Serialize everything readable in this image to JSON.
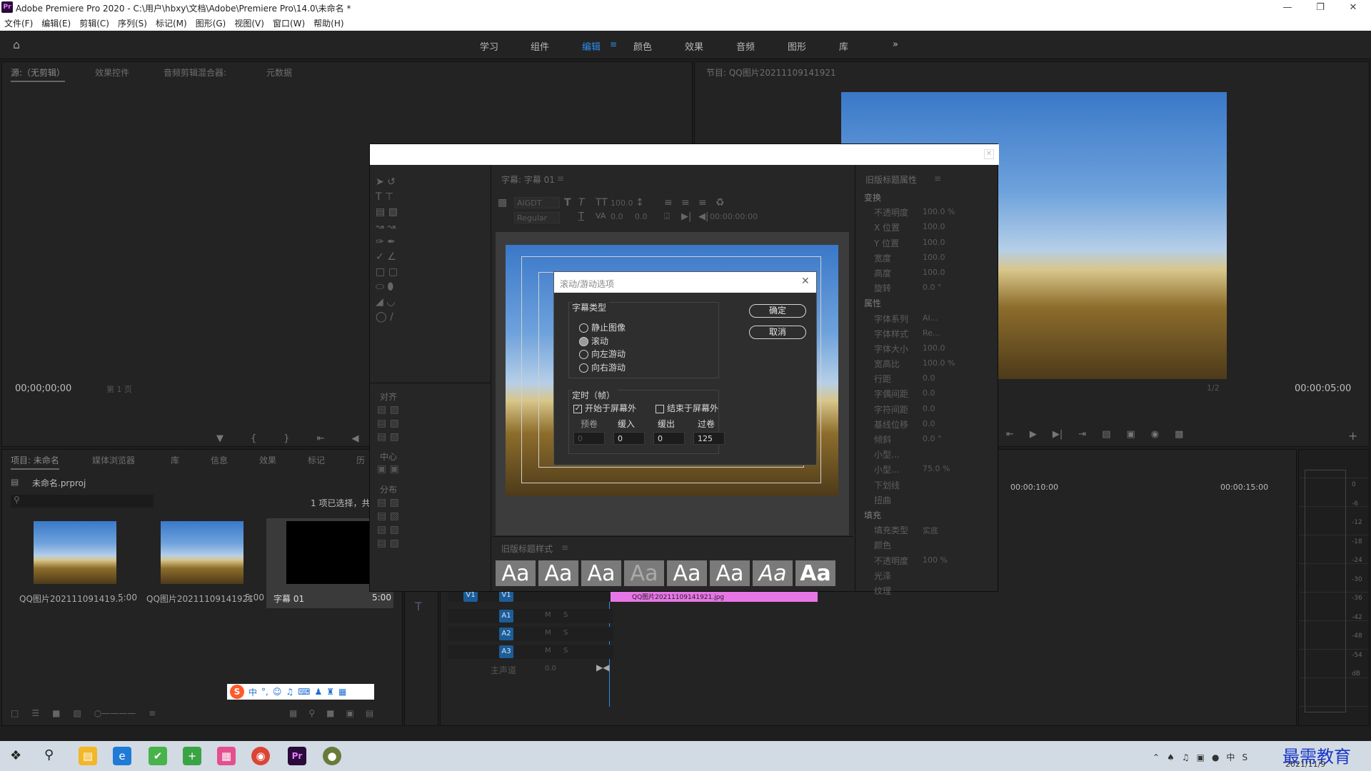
{
  "window": {
    "title": "Adobe Premiere Pro 2020 - C:\\用户\\hbxy\\文档\\Adobe\\Premiere Pro\\14.0\\未命名 *",
    "app_icon": "Pr"
  },
  "menu": [
    "文件(F)",
    "编辑(E)",
    "剪辑(C)",
    "序列(S)",
    "标记(M)",
    "图形(G)",
    "视图(V)",
    "窗口(W)",
    "帮助(H)"
  ],
  "workspaces": [
    "学习",
    "组件",
    "编辑",
    "颜色",
    "效果",
    "音频",
    "图形",
    "库"
  ],
  "active_workspace": "编辑",
  "source_panel": {
    "tabs": [
      "源:（无剪辑）",
      "效果控件",
      "音频剪辑混合器:",
      "元数据"
    ],
    "timecode": "00;00;00;00",
    "page": "第 1 页"
  },
  "program_panel": {
    "title": "节目: QQ图片20211109141921",
    "timecode": "00:00:05:00",
    "zoom": "1/2"
  },
  "project_panel": {
    "tabs": [
      "项目: 未命名",
      "媒体浏览器",
      "库",
      "信息",
      "效果",
      "标记",
      "历"
    ],
    "file": "未命名.prproj",
    "selection": "1 项已选择，共",
    "items": [
      {
        "name": "QQ图片202111091419...",
        "dur": "5:00"
      },
      {
        "name": "QQ图片20211109141921",
        "dur": "5:00"
      },
      {
        "name": "字幕 01",
        "dur": "5:00"
      }
    ]
  },
  "timeline": {
    "ruler": [
      "00:00:10:00",
      "00:00:15:00"
    ],
    "tracks": [
      "V1",
      "A1",
      "A2",
      "A3"
    ],
    "master": "主声道",
    "master_val": "0.0",
    "clip_label": "QQ图片20211109141921.jpg",
    "track_btns": [
      "M",
      "S"
    ]
  },
  "meters": {
    "scale": [
      "0",
      "-6",
      "-12",
      "-18",
      "-24",
      "-30",
      "-36",
      "-42",
      "-48",
      "-54",
      "dB"
    ]
  },
  "legacy_title": {
    "panel_title": "字幕: 字幕 01",
    "font_family": "AIGDT",
    "font_style": "Regular",
    "font_size": "100.0",
    "kerning": "0.0",
    "leading": "0.0",
    "tab_time": "00:00:00:00",
    "align_label": "对齐",
    "center_label": "中心",
    "distribute_label": "分布",
    "styles_title": "旧版标题样式",
    "style_sample": "Aa",
    "props_title": "旧版标题属性",
    "props": [
      {
        "group": "变换"
      },
      {
        "label": "不透明度",
        "value": "100.0 %"
      },
      {
        "label": "X 位置",
        "value": "100.0"
      },
      {
        "label": "Y 位置",
        "value": "100.0"
      },
      {
        "label": "宽度",
        "value": "100.0"
      },
      {
        "label": "高度",
        "value": "100.0"
      },
      {
        "label": "旋转",
        "value": "0.0 °"
      },
      {
        "group": "属性"
      },
      {
        "label": "字体系列",
        "value": "AI..."
      },
      {
        "label": "字体样式",
        "value": "Re..."
      },
      {
        "label": "字体大小",
        "value": "100.0"
      },
      {
        "label": "宽高比",
        "value": "100.0 %"
      },
      {
        "label": "行距",
        "value": "0.0"
      },
      {
        "label": "字偶间距",
        "value": "0.0"
      },
      {
        "label": "字符间距",
        "value": "0.0"
      },
      {
        "label": "基线位移",
        "value": "0.0"
      },
      {
        "label": "倾斜",
        "value": "0.0 °"
      },
      {
        "label": "小型...",
        "value": ""
      },
      {
        "label": "小型...",
        "value": "75.0 %"
      },
      {
        "label": "下划线",
        "value": ""
      },
      {
        "label": "扭曲",
        "value": ""
      },
      {
        "group": "填充"
      },
      {
        "label": "填充类型",
        "value": "实底"
      },
      {
        "label": "颜色",
        "value": ""
      },
      {
        "label": "不透明度",
        "value": "100 %"
      },
      {
        "label": "光泽",
        "value": ""
      },
      {
        "label": "纹理",
        "value": ""
      }
    ]
  },
  "dialog": {
    "title": "滚动/游动选项",
    "caption_type_label": "字幕类型",
    "caption_types": [
      "静止图像",
      "滚动",
      "向左游动",
      "向右游动"
    ],
    "selected_type": "滚动",
    "timing_label": "定时（帧）",
    "start_offscreen": "开始于屏幕外",
    "start_offscreen_checked": true,
    "end_offscreen": "结束于屏幕外",
    "end_offscreen_checked": false,
    "fields": [
      {
        "label": "预卷",
        "value": "0"
      },
      {
        "label": "缓入",
        "value": "0"
      },
      {
        "label": "缓出",
        "value": "0"
      },
      {
        "label": "过卷",
        "value": "125"
      }
    ],
    "ok": "确定",
    "cancel": "取消"
  },
  "taskbar": {
    "date": "2021/11/9",
    "watermark": "最需教育"
  },
  "ime": {
    "label": "中"
  }
}
